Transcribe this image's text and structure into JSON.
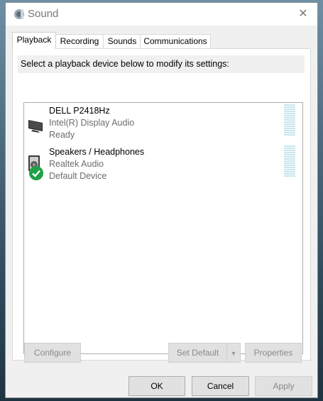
{
  "window": {
    "title": "Sound",
    "close_glyph": "✕"
  },
  "tabs": [
    {
      "label": "Playback",
      "active": true
    },
    {
      "label": "Recording",
      "active": false
    },
    {
      "label": "Sounds",
      "active": false
    },
    {
      "label": "Communications",
      "active": false
    }
  ],
  "instruction": "Select a playback device below to modify its settings:",
  "devices": [
    {
      "name": "DELL P2418Hz",
      "driver": "Intel(R) Display Audio",
      "status": "Ready",
      "icon": "monitor-icon",
      "default": false
    },
    {
      "name": "Speakers / Headphones",
      "driver": "Realtek Audio",
      "status": "Default Device",
      "icon": "speaker-icon",
      "default": true
    }
  ],
  "buttons": {
    "configure": "Configure",
    "set_default": "Set Default",
    "properties": "Properties",
    "ok": "OK",
    "cancel": "Cancel",
    "apply": "Apply"
  },
  "colors": {
    "accent_green": "#1fa046",
    "meter": "#c9e6ec"
  }
}
